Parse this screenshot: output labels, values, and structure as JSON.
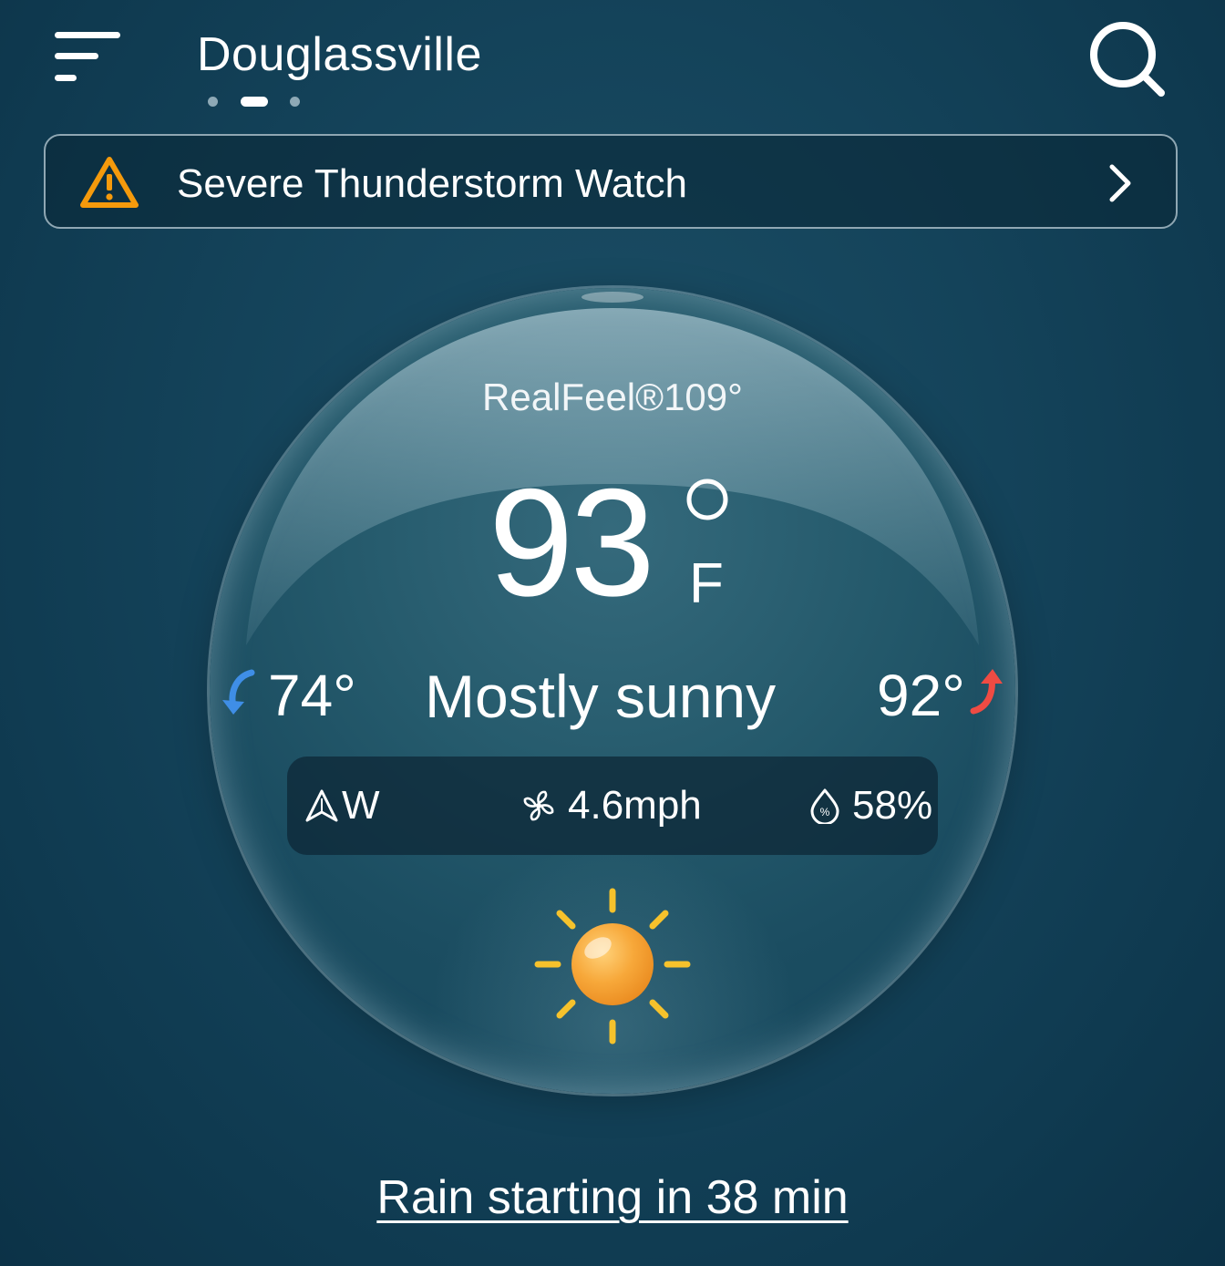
{
  "header": {
    "city": "Douglassville",
    "page_count": 3,
    "active_page": 1,
    "menu_icon": "menu-icon",
    "search_icon": "search-icon"
  },
  "alert": {
    "text": "Severe Thunderstorm Watch",
    "icon": "warning-icon",
    "icon_color": "#f59a0c"
  },
  "current": {
    "realfeel": "RealFeel®109°",
    "temperature": "93",
    "unit": "F",
    "low": "74°",
    "high": "92°",
    "condition": "Mostly sunny",
    "low_arrow_color": "#3f8ee6",
    "high_arrow_color": "#ef4b43",
    "condition_icon": "sun-icon"
  },
  "stats": {
    "wind_direction": "W",
    "wind_speed": "4.6mph",
    "humidity": "58%"
  },
  "precip": {
    "text": "Rain starting in 38 min"
  }
}
